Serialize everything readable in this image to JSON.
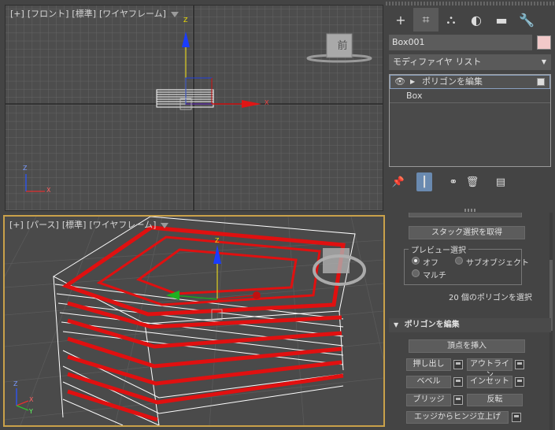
{
  "front_viewport": {
    "label_plus": "[+]",
    "label_view": "[フロント]",
    "label_shading": "[標準]",
    "label_mode": "[ワイヤフレーム]",
    "viewcube_face": "前",
    "axis_z": "Z",
    "axis_x": "X"
  },
  "persp_viewport": {
    "label_plus": "[+]",
    "label_view": "[パース]",
    "label_shading": "[標準]",
    "label_mode": "[ワイヤフレーム]",
    "axis_z": "Z",
    "axis_x": "X",
    "axis_y": "Y"
  },
  "command_panel": {
    "tabs": [
      {
        "icon": "plus-icon",
        "label": "+"
      },
      {
        "icon": "modify-icon",
        "label": "⌗"
      },
      {
        "icon": "hierarchy-icon",
        "label": "⛬"
      },
      {
        "icon": "motion-icon",
        "label": "◐"
      },
      {
        "icon": "display-icon",
        "label": "▬"
      },
      {
        "icon": "utilities-icon",
        "label": "🔧"
      }
    ],
    "object_name": "Box001",
    "object_color": "#f2c9c9",
    "modifier_list": "モディファイヤ リスト",
    "stack": [
      {
        "label": "ポリゴンを編集",
        "selected": true
      },
      {
        "label": "Box",
        "selected": false
      }
    ],
    "get_stack_selection": "スタック選択を取得",
    "preview_group": "プレビュー選択",
    "preview_options": [
      "オフ",
      "サブオブジェクト",
      "マルチ"
    ],
    "selection_info": "20 個のポリゴンを選択",
    "edit_poly_rollout": "ポリゴンを編集",
    "insert_vertex": "頂点を挿入",
    "extrude": "押し出し",
    "outline": "アウトライン",
    "bevel": "ベベル",
    "inset": "インセット",
    "bridge": "ブリッジ",
    "flip": "反転",
    "hinge_from_edge": "エッジからヒンジ立上げ"
  }
}
